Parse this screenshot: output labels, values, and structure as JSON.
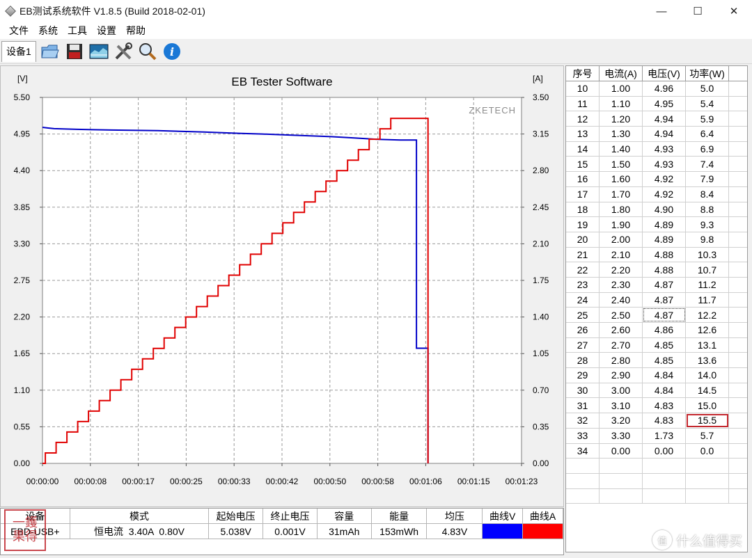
{
  "window": {
    "title": "EB测试系统软件 V1.8.5 (Build 2018-02-01)",
    "minimize": "—",
    "maximize": "☐",
    "close": "✕"
  },
  "menu": [
    "文件",
    "系统",
    "工具",
    "设置",
    "帮助"
  ],
  "toolbar": {
    "device_tab": "设备1",
    "buttons": [
      "open-folder-icon",
      "save-icon",
      "chart-view-icon",
      "tools-icon",
      "magnifier-icon",
      "info-icon"
    ]
  },
  "chart_data": {
    "type": "line",
    "title": "EB Tester Software",
    "watermark": "ZKETECH",
    "left_unit": "[V]",
    "right_unit": "[A]",
    "y_left_ticks": [
      "5.50",
      "4.95",
      "4.40",
      "3.85",
      "3.30",
      "2.75",
      "2.20",
      "1.65",
      "1.10",
      "0.55",
      "0.00"
    ],
    "y_right_ticks": [
      "3.50",
      "3.15",
      "2.80",
      "2.45",
      "2.10",
      "1.75",
      "1.40",
      "1.05",
      "0.70",
      "0.35",
      "0.00"
    ],
    "x_ticks": [
      "00:00:00",
      "00:00:08",
      "00:00:17",
      "00:00:25",
      "00:00:33",
      "00:00:42",
      "00:00:50",
      "00:00:58",
      "00:01:06",
      "00:01:15",
      "00:01:23"
    ],
    "ylim_left": [
      0,
      5.5
    ],
    "ylim_right": [
      0,
      3.5
    ],
    "xlim_seconds": [
      0,
      83
    ],
    "grid": true,
    "series": [
      {
        "axis": "left",
        "color": "#0000c8",
        "points": [
          [
            0,
            5.05
          ],
          [
            1,
            5.04
          ],
          [
            2,
            5.03
          ],
          [
            6,
            5.02
          ],
          [
            12,
            5.01
          ],
          [
            20,
            5.0
          ],
          [
            28,
            4.98
          ],
          [
            34,
            4.96
          ],
          [
            38,
            4.95
          ],
          [
            44,
            4.93
          ],
          [
            50,
            4.91
          ],
          [
            54,
            4.89
          ],
          [
            58,
            4.87
          ],
          [
            62,
            4.86
          ],
          [
            64.8,
            4.86
          ],
          [
            64.8,
            1.73
          ],
          [
            66.8,
            1.73
          ],
          [
            66.8,
            0.0
          ]
        ]
      },
      {
        "axis": "right",
        "color": "#e00000",
        "step_seconds": 1.87,
        "start_value": 0.1,
        "step_value": 0.1,
        "steps": 32,
        "drop_time": 66.8
      }
    ]
  },
  "table": {
    "headers": [
      "序号",
      "电流(A)",
      "电压(V)",
      "功率(W)"
    ],
    "rows": [
      [
        "10",
        "1.00",
        "4.96",
        "5.0"
      ],
      [
        "11",
        "1.10",
        "4.95",
        "5.4"
      ],
      [
        "12",
        "1.20",
        "4.94",
        "5.9"
      ],
      [
        "13",
        "1.30",
        "4.94",
        "6.4"
      ],
      [
        "14",
        "1.40",
        "4.93",
        "6.9"
      ],
      [
        "15",
        "1.50",
        "4.93",
        "7.4"
      ],
      [
        "16",
        "1.60",
        "4.92",
        "7.9"
      ],
      [
        "17",
        "1.70",
        "4.92",
        "8.4"
      ],
      [
        "18",
        "1.80",
        "4.90",
        "8.8"
      ],
      [
        "19",
        "1.90",
        "4.89",
        "9.3"
      ],
      [
        "20",
        "2.00",
        "4.89",
        "9.8"
      ],
      [
        "21",
        "2.10",
        "4.88",
        "10.3"
      ],
      [
        "22",
        "2.20",
        "4.88",
        "10.7"
      ],
      [
        "23",
        "2.30",
        "4.87",
        "11.2"
      ],
      [
        "24",
        "2.40",
        "4.87",
        "11.7"
      ],
      [
        "25",
        "2.50",
        "4.87",
        "12.2"
      ],
      [
        "26",
        "2.60",
        "4.86",
        "12.6"
      ],
      [
        "27",
        "2.70",
        "4.85",
        "13.1"
      ],
      [
        "28",
        "2.80",
        "4.85",
        "13.6"
      ],
      [
        "29",
        "2.90",
        "4.84",
        "14.0"
      ],
      [
        "30",
        "3.00",
        "4.84",
        "14.5"
      ],
      [
        "31",
        "3.10",
        "4.83",
        "15.0"
      ],
      [
        "32",
        "3.20",
        "4.83",
        "15.5"
      ],
      [
        "33",
        "3.30",
        "1.73",
        "5.7"
      ],
      [
        "34",
        "0.00",
        "0.00",
        "0.0"
      ]
    ],
    "highlight_cell": {
      "row": 22,
      "col": 3,
      "color": "#c4282e"
    },
    "selected_cell": {
      "row": 15,
      "col": 2
    }
  },
  "summary": {
    "headers": [
      "设备",
      "模式",
      "起始电压",
      "终止电压",
      "容量",
      "能量",
      "均压",
      "曲线V",
      "曲线A"
    ],
    "values": [
      "EBD-USB+",
      "恒电流  3.40A  0.80V",
      "5.038V",
      "0.001V",
      "31mAh",
      "153mWh",
      "4.83V",
      "",
      ""
    ],
    "curve_colors": [
      "#0000ff",
      "#ff0000"
    ]
  },
  "stamp": {
    "line1": "一鑊",
    "line2": "果得"
  },
  "watermark": {
    "icon": "值",
    "text": "什么值得买"
  }
}
